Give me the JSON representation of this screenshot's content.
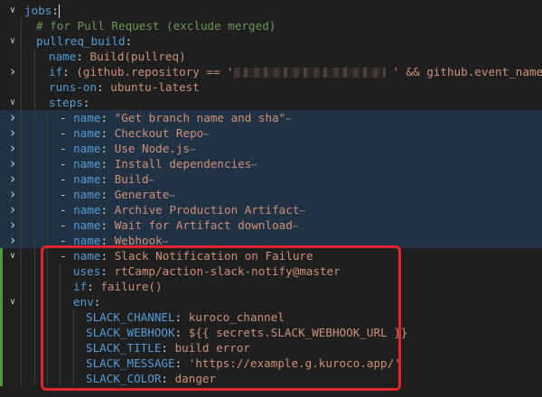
{
  "editor": {
    "lines": [
      {
        "id": "jobs",
        "parts": [
          {
            "t": "jobs",
            "c": "k"
          },
          {
            "t": ":",
            "c": "p"
          }
        ],
        "cursor": true
      },
      {
        "id": "comment",
        "parts": [
          {
            "t": "# for Pull Request (exclude merged)",
            "c": "c"
          }
        ]
      },
      {
        "id": "pullreq-build",
        "parts": [
          {
            "t": "pullreq_build",
            "c": "k"
          },
          {
            "t": ":",
            "c": "p"
          }
        ]
      },
      {
        "id": "name",
        "parts": [
          {
            "t": "name",
            "c": "k"
          },
          {
            "t": ": ",
            "c": "p"
          },
          {
            "t": "Build(pullreq)",
            "c": "v"
          }
        ]
      },
      {
        "id": "if",
        "parts": [
          {
            "t": "if",
            "c": "k"
          },
          {
            "t": ": ",
            "c": "p"
          },
          {
            "t": "(github.repository == '",
            "c": "v"
          },
          {
            "t": "",
            "c": "blur"
          },
          {
            "t": " ' && github.event_name == 'i",
            "c": "v"
          }
        ]
      },
      {
        "id": "runs-on",
        "parts": [
          {
            "t": "runs-on",
            "c": "k"
          },
          {
            "t": ": ",
            "c": "p"
          },
          {
            "t": "ubuntu-latest",
            "c": "v"
          }
        ]
      },
      {
        "id": "steps",
        "parts": [
          {
            "t": "steps",
            "c": "k"
          },
          {
            "t": ":",
            "c": "p"
          }
        ]
      },
      {
        "id": "step-1",
        "parts": [
          {
            "t": "- ",
            "c": "dash"
          },
          {
            "t": "name",
            "c": "k"
          },
          {
            "t": ": ",
            "c": "p"
          },
          {
            "t": "\"Get branch name and sha\"",
            "c": "v"
          },
          {
            "t": "⋯",
            "c": "ell"
          }
        ]
      },
      {
        "id": "step-2",
        "parts": [
          {
            "t": "- ",
            "c": "dash"
          },
          {
            "t": "name",
            "c": "k"
          },
          {
            "t": ": ",
            "c": "p"
          },
          {
            "t": "Checkout Repo",
            "c": "v"
          },
          {
            "t": "⋯",
            "c": "ell"
          }
        ]
      },
      {
        "id": "step-3",
        "parts": [
          {
            "t": "- ",
            "c": "dash"
          },
          {
            "t": "name",
            "c": "k"
          },
          {
            "t": ": ",
            "c": "p"
          },
          {
            "t": "Use Node.js",
            "c": "v"
          },
          {
            "t": "⋯",
            "c": "ell"
          }
        ]
      },
      {
        "id": "step-4",
        "parts": [
          {
            "t": "- ",
            "c": "dash"
          },
          {
            "t": "name",
            "c": "k"
          },
          {
            "t": ": ",
            "c": "p"
          },
          {
            "t": "Install dependencies",
            "c": "v"
          },
          {
            "t": "⋯",
            "c": "ell"
          }
        ]
      },
      {
        "id": "step-5",
        "parts": [
          {
            "t": "- ",
            "c": "dash"
          },
          {
            "t": "name",
            "c": "k"
          },
          {
            "t": ": ",
            "c": "p"
          },
          {
            "t": "Build",
            "c": "v"
          },
          {
            "t": "⋯",
            "c": "ell"
          }
        ]
      },
      {
        "id": "step-6",
        "parts": [
          {
            "t": "- ",
            "c": "dash"
          },
          {
            "t": "name",
            "c": "k"
          },
          {
            "t": ": ",
            "c": "p"
          },
          {
            "t": "Generate",
            "c": "v"
          },
          {
            "t": "⋯",
            "c": "ell"
          }
        ]
      },
      {
        "id": "step-7",
        "parts": [
          {
            "t": "- ",
            "c": "dash"
          },
          {
            "t": "name",
            "c": "k"
          },
          {
            "t": ": ",
            "c": "p"
          },
          {
            "t": "Archive Production Artifact",
            "c": "v"
          },
          {
            "t": "⋯",
            "c": "ell"
          }
        ]
      },
      {
        "id": "step-8",
        "parts": [
          {
            "t": "- ",
            "c": "dash"
          },
          {
            "t": "name",
            "c": "k"
          },
          {
            "t": ": ",
            "c": "p"
          },
          {
            "t": "Wait for Artifact download",
            "c": "v"
          },
          {
            "t": "⋯",
            "c": "ell"
          }
        ]
      },
      {
        "id": "step-9",
        "parts": [
          {
            "t": "- ",
            "c": "dash"
          },
          {
            "t": "name",
            "c": "k"
          },
          {
            "t": ": ",
            "c": "p"
          },
          {
            "t": "Webhook",
            "c": "v"
          },
          {
            "t": "⋯",
            "c": "ell"
          }
        ]
      },
      {
        "id": "step-slack",
        "parts": [
          {
            "t": "- ",
            "c": "dash"
          },
          {
            "t": "name",
            "c": "k"
          },
          {
            "t": ": ",
            "c": "p"
          },
          {
            "t": "Slack Notification on Failure",
            "c": "v"
          }
        ]
      },
      {
        "id": "uses",
        "parts": [
          {
            "t": "uses",
            "c": "k"
          },
          {
            "t": ": ",
            "c": "p"
          },
          {
            "t": "rtCamp/action-slack-notify@master",
            "c": "v"
          }
        ]
      },
      {
        "id": "if-failure",
        "parts": [
          {
            "t": "if",
            "c": "k"
          },
          {
            "t": ": ",
            "c": "p"
          },
          {
            "t": "failure()",
            "c": "v"
          }
        ]
      },
      {
        "id": "env",
        "parts": [
          {
            "t": "env",
            "c": "k"
          },
          {
            "t": ":",
            "c": "p"
          }
        ]
      },
      {
        "id": "slack-channel",
        "parts": [
          {
            "t": "SLACK_CHANNEL",
            "c": "k"
          },
          {
            "t": ": ",
            "c": "p"
          },
          {
            "t": "kuroco_channel",
            "c": "v"
          }
        ]
      },
      {
        "id": "slack-webhook",
        "parts": [
          {
            "t": "SLACK_WEBHOOK",
            "c": "k"
          },
          {
            "t": ": ",
            "c": "p"
          },
          {
            "t": "${{ secrets.SLACK_WEBHOOK_URL }}",
            "c": "v"
          }
        ]
      },
      {
        "id": "slack-title",
        "parts": [
          {
            "t": "SLACK_TITLE",
            "c": "k"
          },
          {
            "t": ": ",
            "c": "p"
          },
          {
            "t": "build error",
            "c": "v"
          }
        ]
      },
      {
        "id": "slack-message",
        "parts": [
          {
            "t": "SLACK_MESSAGE",
            "c": "k"
          },
          {
            "t": ": ",
            "c": "p"
          },
          {
            "t": "'https://example.g.kuroco.app/'",
            "c": "v"
          }
        ]
      },
      {
        "id": "slack-color",
        "parts": [
          {
            "t": "SLACK_COLOR",
            "c": "k"
          },
          {
            "t": ": ",
            "c": "p"
          },
          {
            "t": "danger",
            "c": "v"
          }
        ]
      }
    ]
  },
  "colors": {
    "background": "#1f1f1f",
    "key": "#569cd6",
    "string": "#ce9178",
    "comment": "#6a9955",
    "folded_highlight": "#223245",
    "annotation_box": "#e0262c"
  }
}
